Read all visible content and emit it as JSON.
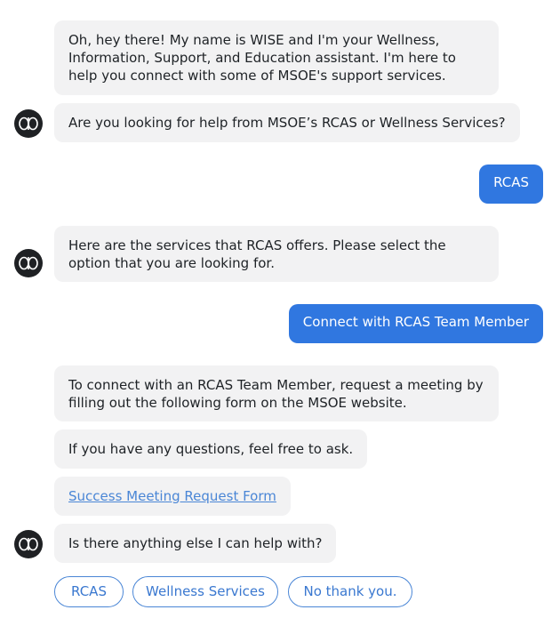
{
  "messages": {
    "bot_intro": "Oh, hey there! My name is WISE and I'm your Wellness, Information, Support, and Education assistant. I'm here to help you connect with some of MSOE's support services.",
    "bot_question": "Are you looking for help from MSOE’s RCAS or Wellness Services?",
    "user_rcas": "RCAS",
    "bot_services": "Here are the services that RCAS offers. Please select the option that you are looking for.",
    "user_connect": "Connect with RCAS Team Member",
    "bot_connect_info": "To connect with an RCAS Team Member, request a meeting by filling out the following form on the MSOE website.",
    "bot_questions": "If you have any questions, feel free to ask.",
    "bot_link": "Success Meeting Request Form",
    "bot_anything_else": "Is there anything else I can help with?"
  },
  "quick_replies": {
    "rcas": "RCAS",
    "wellness": "Wellness Services",
    "no_thanks": "No thank you."
  },
  "colors": {
    "bot_bubble": "#f2f2f3",
    "user_bubble": "#3077e0",
    "accent": "#4a86d6",
    "avatar": "#1f2124"
  },
  "icons": {
    "avatar": "wise-bot-logo-icon"
  }
}
